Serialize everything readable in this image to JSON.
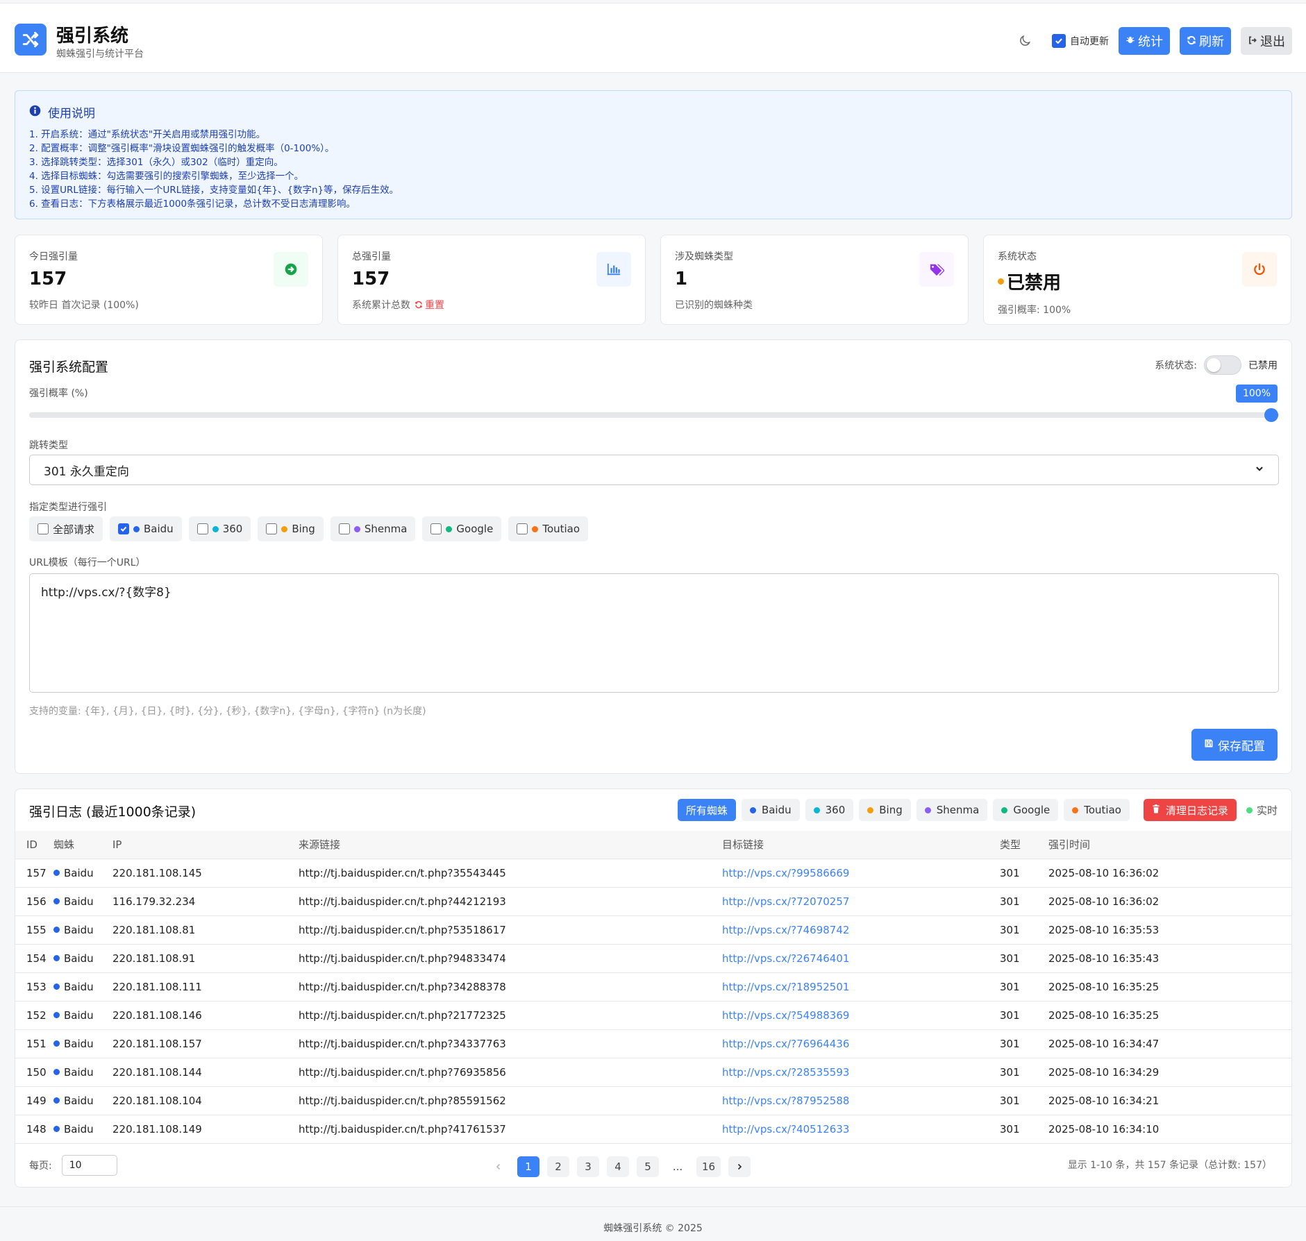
{
  "header": {
    "title": "强引系统",
    "subtitle": "蜘蛛强引与统计平台",
    "auto_update_label": "自动更新",
    "stats_label": "统计",
    "refresh_label": "刷新",
    "logout_label": "退出",
    "icons": {
      "logo": "shuffle-icon",
      "theme": "moon-icon",
      "stats": "bug-icon",
      "refresh": "refresh-icon",
      "logout": "sign-out-icon"
    }
  },
  "info": {
    "title": "使用说明",
    "lines": [
      "1. 开启系统：通过\"系统状态\"开关启用或禁用强引功能。",
      "2. 配置概率：调整\"强引概率\"滑块设置蜘蛛强引的触发概率（0-100%）。",
      "3. 选择跳转类型：选择301（永久）或302（临时）重定向。",
      "4. 选择目标蜘蛛：勾选需要强引的搜索引擎蜘蛛，至少选择一个。",
      "5. 设置URL链接：每行输入一个URL链接，支持变量如{年}、{数字n}等，保存后生效。",
      "6. 查看日志：下方表格展示最近1000条强引记录，总计数不受日志清理影响。"
    ]
  },
  "stats": [
    {
      "label": "今日强引量",
      "value": "157",
      "sub": "较昨日 首次记录 (100%)",
      "icon": "arrow-right-circle-icon",
      "color": "#16a34a",
      "bg": "#f0fdf4"
    },
    {
      "label": "总强引量",
      "value": "157",
      "sub": "系统累计总数",
      "reset": "重置",
      "icon": "bar-chart-icon",
      "color": "#3b82f6",
      "bg": "#eff6ff"
    },
    {
      "label": "涉及蜘蛛类型",
      "value": "1",
      "sub": "已识别的蜘蛛种类",
      "icon": "tags-icon",
      "color": "#9333ea",
      "bg": "#faf5ff"
    },
    {
      "label": "系统状态",
      "value": "已禁用",
      "sub": "强引概率: 100%",
      "icon": "power-icon",
      "color": "#ea580c",
      "bg": "#fff7ed"
    }
  ],
  "config": {
    "title": "强引系统配置",
    "status_label": "系统状态:",
    "status_value": "已禁用",
    "prob_label": "强引概率 (%)",
    "prob_badge": "100%",
    "prob_value": 100,
    "redirect_label": "跳转类型",
    "redirect_value": "301 永久重定向",
    "spider_label": "指定类型进行强引",
    "spiders": [
      {
        "name": "全部请求",
        "checked": false,
        "color": ""
      },
      {
        "name": "Baidu",
        "checked": true,
        "color": "#2563eb"
      },
      {
        "name": "360",
        "checked": false,
        "color": "#06b6d4"
      },
      {
        "name": "Bing",
        "checked": false,
        "color": "#f59e0b"
      },
      {
        "name": "Shenma",
        "checked": false,
        "color": "#8b5cf6"
      },
      {
        "name": "Google",
        "checked": false,
        "color": "#10b981"
      },
      {
        "name": "Toutiao",
        "checked": false,
        "color": "#f97316"
      }
    ],
    "url_label": "URL模板（每行一个URL）",
    "url_value": "http://vps.cx/?{数字8}",
    "hint": "支持的变量: {年}, {月}, {日}, {时}, {分}, {秒}, {数字n}, {字母n}, {字符n} (n为长度)",
    "save_label": "保存配置"
  },
  "log": {
    "title": "强引日志 (最近1000条记录)",
    "filter_all": "所有蜘蛛",
    "filters": [
      {
        "name": "Baidu",
        "color": "#2563eb"
      },
      {
        "name": "360",
        "color": "#06b6d4"
      },
      {
        "name": "Bing",
        "color": "#f59e0b"
      },
      {
        "name": "Shenma",
        "color": "#8b5cf6"
      },
      {
        "name": "Google",
        "color": "#10b981"
      },
      {
        "name": "Toutiao",
        "color": "#f97316"
      }
    ],
    "clear_label": "清理日志记录",
    "realtime_label": "实时",
    "columns": [
      "ID",
      "蜘蛛",
      "IP",
      "来源链接",
      "目标链接",
      "类型",
      "强引时间"
    ],
    "rows": [
      [
        "157",
        "Baidu",
        "220.181.108.145",
        "http://tj.baiduspider.cn/t.php?35543445",
        "http://vps.cx/?99586669",
        "301",
        "2025-08-10 16:36:02"
      ],
      [
        "156",
        "Baidu",
        "116.179.32.234",
        "http://tj.baiduspider.cn/t.php?44212193",
        "http://vps.cx/?72070257",
        "301",
        "2025-08-10 16:36:02"
      ],
      [
        "155",
        "Baidu",
        "220.181.108.81",
        "http://tj.baiduspider.cn/t.php?53518617",
        "http://vps.cx/?74698742",
        "301",
        "2025-08-10 16:35:53"
      ],
      [
        "154",
        "Baidu",
        "220.181.108.91",
        "http://tj.baiduspider.cn/t.php?94833474",
        "http://vps.cx/?26746401",
        "301",
        "2025-08-10 16:35:43"
      ],
      [
        "153",
        "Baidu",
        "220.181.108.111",
        "http://tj.baiduspider.cn/t.php?34288378",
        "http://vps.cx/?18952501",
        "301",
        "2025-08-10 16:35:25"
      ],
      [
        "152",
        "Baidu",
        "220.181.108.146",
        "http://tj.baiduspider.cn/t.php?21772325",
        "http://vps.cx/?54988369",
        "301",
        "2025-08-10 16:35:25"
      ],
      [
        "151",
        "Baidu",
        "220.181.108.157",
        "http://tj.baiduspider.cn/t.php?34337763",
        "http://vps.cx/?76964436",
        "301",
        "2025-08-10 16:34:47"
      ],
      [
        "150",
        "Baidu",
        "220.181.108.144",
        "http://tj.baiduspider.cn/t.php?76935856",
        "http://vps.cx/?28535593",
        "301",
        "2025-08-10 16:34:29"
      ],
      [
        "149",
        "Baidu",
        "220.181.108.104",
        "http://tj.baiduspider.cn/t.php?85591562",
        "http://vps.cx/?87952588",
        "301",
        "2025-08-10 16:34:21"
      ],
      [
        "148",
        "Baidu",
        "220.181.108.149",
        "http://tj.baiduspider.cn/t.php?41761537",
        "http://vps.cx/?40512633",
        "301",
        "2025-08-10 16:34:10"
      ]
    ],
    "per_page_label": "每页:",
    "per_page_value": "10",
    "pages": [
      "1",
      "2",
      "3",
      "4",
      "5",
      "...",
      "16"
    ],
    "current_page": "1",
    "summary": "显示 1-10 条，共 157 条记录（总计数: 157）"
  },
  "footer": "蜘蛛强引系统 © 2025",
  "colors": {
    "accent": "#3b82f6",
    "danger": "#ef4444",
    "baidu": "#2563eb",
    "status_dot": "#f59e0b"
  }
}
